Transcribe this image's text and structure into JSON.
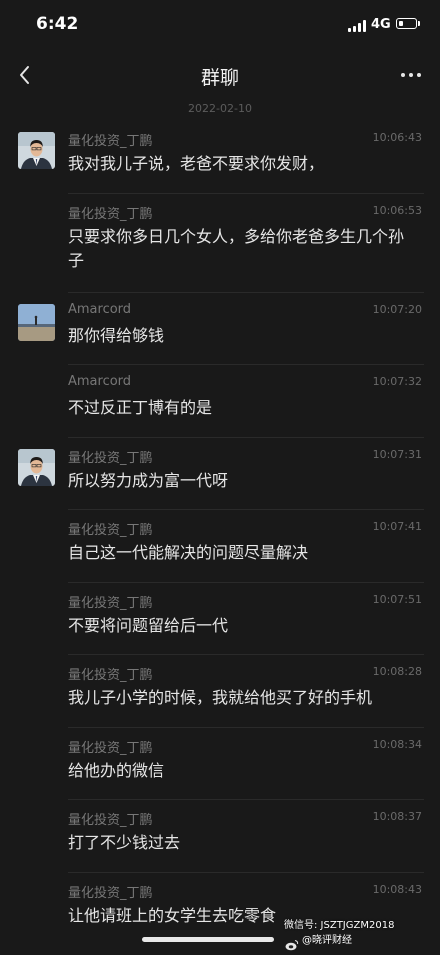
{
  "status": {
    "time": "6:42",
    "network": "4G",
    "battery_level": 0.3
  },
  "nav": {
    "title": "群聊"
  },
  "date_separator": "2022-02-10",
  "messages": [
    {
      "name": "量化投资_丁鹏",
      "time": "10:06:43",
      "text": "我对我儿子说，老爸不要求你发财，",
      "avatar": "ding"
    },
    {
      "name": "量化投资_丁鹏",
      "time": "10:06:53",
      "text": "只要求你多日几个女人，多给你老爸多生几个孙子"
    },
    {
      "name": "Amarcord",
      "time": "10:07:20",
      "text": "那你得给够钱",
      "avatar": "amarcord"
    },
    {
      "name": "Amarcord",
      "time": "10:07:32",
      "text": "不过反正丁博有的是"
    },
    {
      "name": "量化投资_丁鹏",
      "time": "10:07:31",
      "text": "所以努力成为富一代呀",
      "avatar": "ding"
    },
    {
      "name": "量化投资_丁鹏",
      "time": "10:07:41",
      "text": "自己这一代能解决的问题尽量解决"
    },
    {
      "name": "量化投资_丁鹏",
      "time": "10:07:51",
      "text": "不要将问题留给后一代"
    },
    {
      "name": "量化投资_丁鹏",
      "time": "10:08:28",
      "text": "我儿子小学的时候，我就给他买了好的手机"
    },
    {
      "name": "量化投资_丁鹏",
      "time": "10:08:34",
      "text": "给他办的微信"
    },
    {
      "name": "量化投资_丁鹏",
      "time": "10:08:37",
      "text": "打了不少钱过去"
    },
    {
      "name": "量化投资_丁鹏",
      "time": "10:08:43",
      "text": "让他请班上的女学生去吃零食"
    }
  ],
  "watermark": {
    "line1": "微信号: JSZTJGZM2018",
    "line2": "@晓评财经"
  }
}
